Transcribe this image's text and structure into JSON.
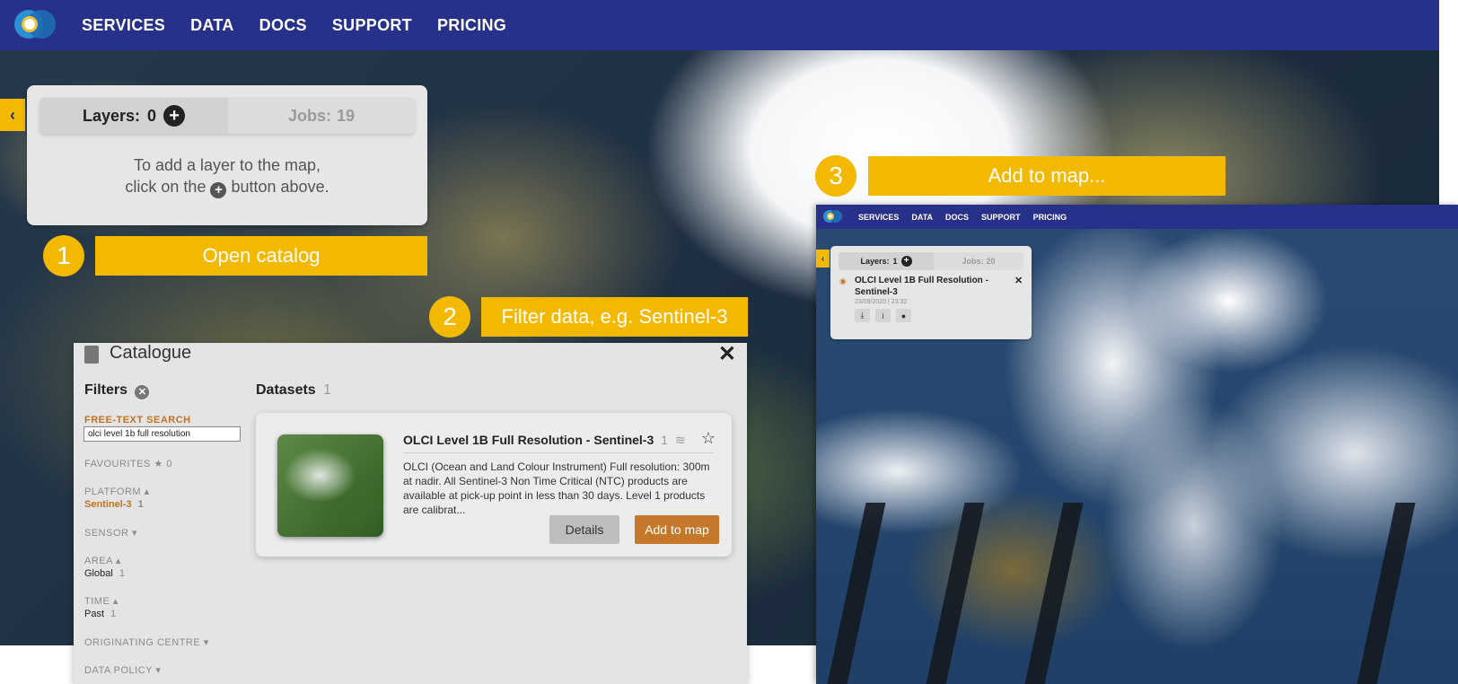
{
  "nav": {
    "items": [
      "SERVICES",
      "DATA",
      "DOCS",
      "SUPPORT",
      "PRICING"
    ]
  },
  "layers_panel": {
    "layers_label": "Layers:",
    "layers_count": "0",
    "jobs_label": "Jobs:",
    "jobs_count": "19",
    "hint_line1": "To add a layer to the map,",
    "hint_line2_pre": "click on the",
    "hint_line2_post": "button above."
  },
  "steps": [
    {
      "number": "1",
      "label": "Open catalog"
    },
    {
      "number": "2",
      "label": "Filter data, e.g. Sentinel-3"
    },
    {
      "number": "3",
      "label": "Add to map..."
    }
  ],
  "catalogue": {
    "title": "Catalogue",
    "filters_label": "Filters",
    "free_text_label": "FREE-TEXT SEARCH",
    "search_value": "olci level 1b full resolution",
    "favourites_label": "FAVOURITES",
    "favourites_count": "0",
    "platform_label": "PLATFORM",
    "platform_value": "Sentinel-3",
    "platform_count": "1",
    "sensor_label": "SENSOR",
    "area_label": "AREA",
    "area_value": "Global",
    "area_count": "1",
    "time_label": "TIME",
    "time_value": "Past",
    "time_count": "1",
    "originating_label": "ORIGINATING CENTRE",
    "data_policy_label": "DATA POLICY",
    "datasets_label": "Datasets",
    "datasets_count": "1",
    "dataset": {
      "title": "OLCI Level 1B Full Resolution - Sentinel-3",
      "layers_count": "1",
      "description": "OLCI (Ocean and Land Colour Instrument) Full resolution: 300m at nadir. All Sentinel-3 Non Time Critical (NTC) products are available at pick-up point in less than 30 days. Level 1 products are calibrat...",
      "details_button": "Details",
      "add_button": "Add to map"
    }
  },
  "overlay": {
    "nav_items": [
      "SERVICES",
      "DATA",
      "DOCS",
      "SUPPORT",
      "PRICING"
    ],
    "layers_label": "Layers:",
    "layers_count": "1",
    "jobs_label": "Jobs:",
    "jobs_count": "20",
    "layer_title": "OLCI Level 1B Full Resolution - Sentinel-3",
    "layer_time": "23/09/2020 | 23:32"
  },
  "colors": {
    "nav_bg": "#27318a",
    "accent_yellow": "#f3b800",
    "add_button": "#c5772a",
    "filter_highlight": "#c07320"
  },
  "icons": [
    "logo-icon",
    "chevron-left-icon",
    "plus-circle-icon",
    "book-icon",
    "close-icon",
    "clear-filter-icon",
    "star-icon",
    "layers-icon",
    "eye-icon",
    "download-icon",
    "info-icon",
    "drop-icon"
  ]
}
